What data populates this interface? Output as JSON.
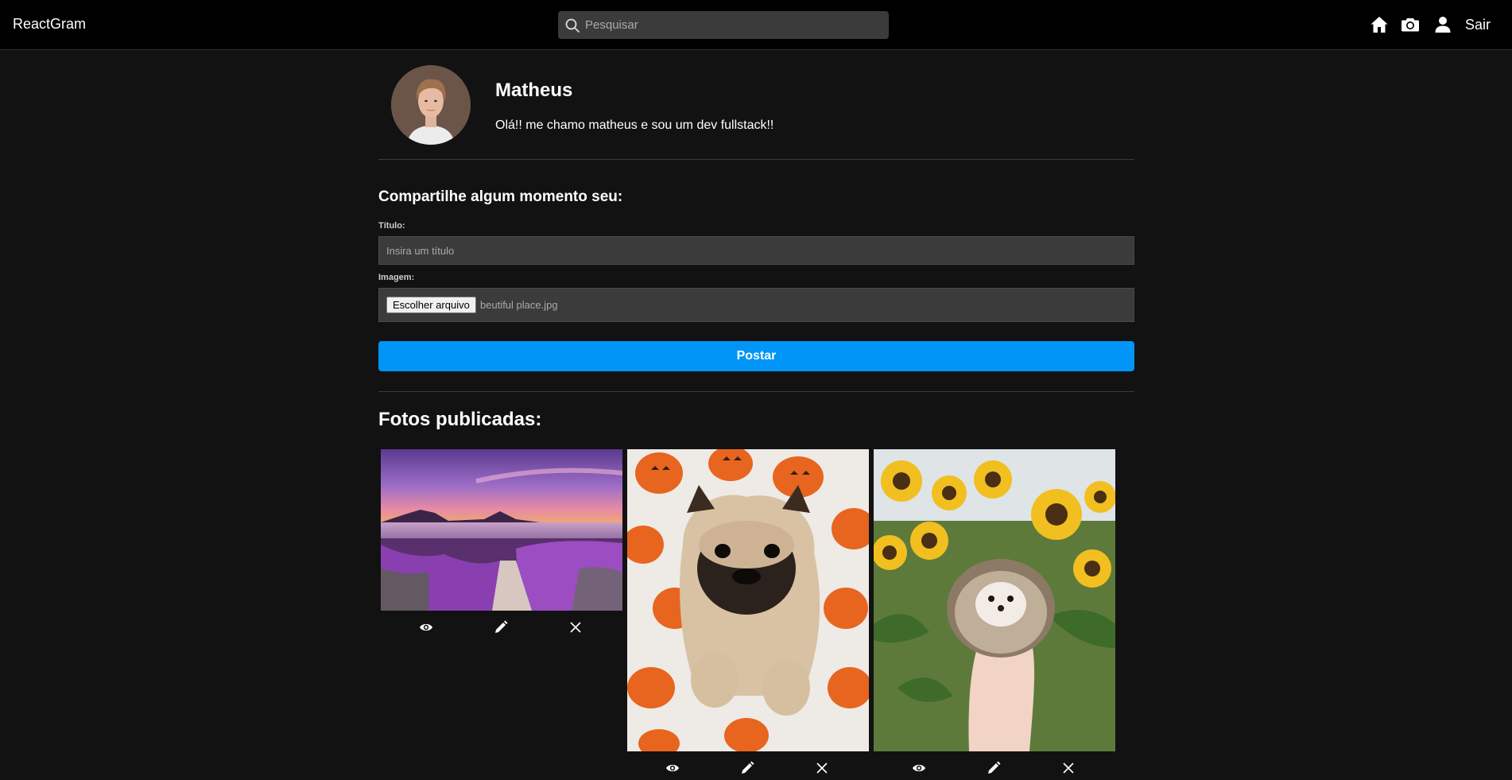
{
  "app": {
    "brand": "ReactGram"
  },
  "search": {
    "placeholder": "Pesquisar"
  },
  "nav": {
    "icons": [
      "home-icon",
      "camera-icon",
      "user-icon"
    ],
    "exit_label": "Sair"
  },
  "profile": {
    "name": "Matheus",
    "bio": "Olá!! me chamo matheus e sou um dev fullstack!!"
  },
  "form": {
    "title": "Compartilhe algum momento seu:",
    "title_label": "Título:",
    "title_placeholder": "Insira um título",
    "image_label": "Imagem:",
    "file_button": "Escolher arquivo",
    "file_name": "beutiful place.jpg",
    "submit": "Postar"
  },
  "photos": {
    "heading": "Fotos publicadas:",
    "items": [
      {
        "subject": "lake-sunset-lavender",
        "actions": [
          "eye-icon",
          "pencil-icon",
          "close-icon"
        ]
      },
      {
        "subject": "pug-pumpkin-blanket",
        "actions": [
          "eye-icon",
          "pencil-icon",
          "close-icon"
        ]
      },
      {
        "subject": "hedgehog-sunflowers",
        "actions": [
          "eye-icon",
          "pencil-icon",
          "close-icon"
        ]
      }
    ]
  },
  "colors": {
    "background": "#121212",
    "navbar": "#000000",
    "input": "#3b3b3b",
    "accent": "#0095f6"
  }
}
